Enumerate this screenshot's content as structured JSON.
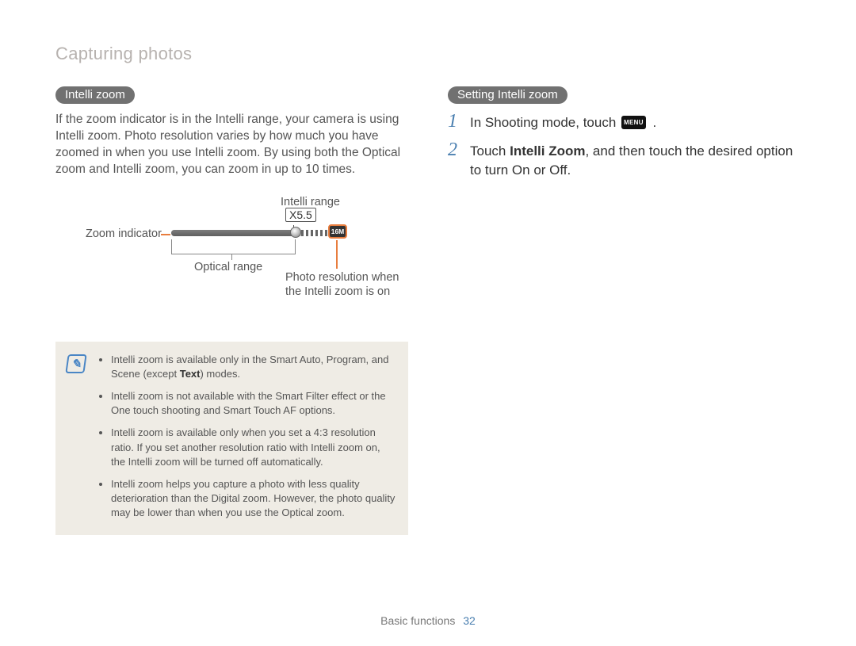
{
  "header": {
    "title": "Capturing photos"
  },
  "left": {
    "pill": "Intelli zoom",
    "paragraph": "If the zoom indicator is in the Intelli range, your camera is using Intelli zoom. Photo resolution varies by how much you have zoomed in when you use Intelli zoom. By using both the Optical zoom and Intelli zoom, you can zoom in up to 10 times.",
    "diagram": {
      "intelli_range": "Intelli range",
      "zoom_indicator": "Zoom indicator",
      "optical_range": "Optical range",
      "photo_res_line1": "Photo resolution when",
      "photo_res_line2": "the Intelli zoom is on",
      "zoom_value": "X5.5",
      "res_icon_label": "16M"
    },
    "notes": [
      {
        "pre": "Intelli zoom is available only in the Smart Auto, Program, and Scene (except ",
        "bold": "Text",
        "post": ") modes."
      },
      {
        "text": "Intelli zoom is not available with the Smart Filter effect or the One touch shooting and Smart Touch AF options."
      },
      {
        "text": "Intelli zoom is available only when you set a 4:3 resolution ratio. If you set another resolution ratio with Intelli zoom on, the Intelli zoom will be turned off automatically."
      },
      {
        "text": "Intelli zoom helps you capture a photo with less quality deterioration than the Digital zoom. However, the photo quality may be lower than when you use the Optical zoom."
      }
    ]
  },
  "right": {
    "pill": "Setting Intelli zoom",
    "steps": [
      {
        "num": "1",
        "text_before": "In Shooting mode, touch ",
        "menu_icon": "MENU",
        "text_after": "."
      },
      {
        "num": "2",
        "text_before": "Touch ",
        "bold": "Intelli Zoom",
        "text_after": ", and then touch the desired option to turn On or Off."
      }
    ]
  },
  "footer": {
    "section": "Basic functions",
    "page": "32"
  }
}
